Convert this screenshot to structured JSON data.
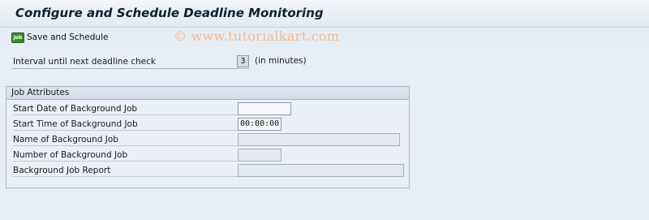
{
  "title": "Configure and Schedule Deadline Monitoring",
  "toolbar": {
    "save_label": "Save and Schedule",
    "save_icon_text": "Job"
  },
  "watermark": "© www.tutorialkart.com",
  "interval": {
    "label": "Interval until next deadline check",
    "value": "3",
    "unit": "(in minutes)"
  },
  "job_attributes": {
    "title": "Job Attributes",
    "start_date": {
      "label": "Start Date of Background Job",
      "value": ""
    },
    "start_time": {
      "label": "Start Time of Background Job",
      "value": "00:00:00"
    },
    "job_name": {
      "label": "Name of Background Job",
      "value": ""
    },
    "job_number": {
      "label": "Number of Background Job",
      "value": ""
    },
    "job_report": {
      "label": "Background Job Report",
      "value": ""
    }
  },
  "colors": {
    "background": "#e8eef5",
    "job_icon": "#3a8d2b",
    "watermark": "#f2b98e"
  },
  "icons": {
    "save": "job-icon"
  }
}
